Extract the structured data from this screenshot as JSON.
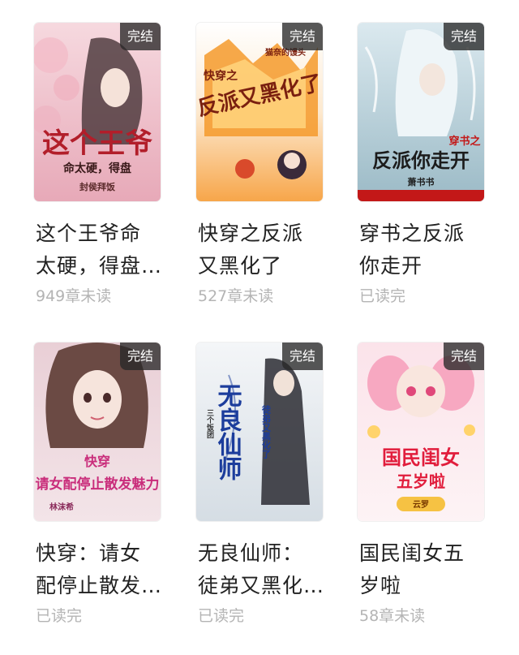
{
  "badge_label": "完结",
  "books": [
    {
      "title_line1": "这个王爷命",
      "title_line2": "太硬，得盘…",
      "status": "949章未读",
      "cover": {
        "main_text": "这个王爷",
        "sub_text": "命太硬，得盘",
        "author": "封侯拜饭",
        "bg_top": "#f6d9df",
        "bg_bottom": "#e7a9b8",
        "accent": "#b21e2a"
      }
    },
    {
      "title_line1": "快穿之反派",
      "title_line2": "又黑化了",
      "status": "527章未读",
      "cover": {
        "main_text": "反派又黑化了",
        "sub_text": "快穿之",
        "author": "猫奈的馒头",
        "bg_top": "#ffffff",
        "bg_bottom": "#f7a64a",
        "accent": "#7a1f0f"
      }
    },
    {
      "title_line1": "穿书之反派",
      "title_line2": "你走开",
      "status": "已读完",
      "cover": {
        "main_text": "反派你走开",
        "sub_text": "穿书之",
        "author": "萧书书",
        "bg_top": "#dbe9ef",
        "bg_bottom": "#9bbac6",
        "accent": "#1c1c1c"
      }
    },
    {
      "title_line1": "快穿：请女",
      "title_line2": "配停止散发…",
      "status": "已读完",
      "cover": {
        "main_text": "请女配停止散发魅力",
        "sub_text": "快穿",
        "author": "林沫希",
        "bg_top": "#e9cfd6",
        "bg_bottom": "#f3e4e8",
        "accent": "#c92d7b"
      }
    },
    {
      "title_line1": "无良仙师：",
      "title_line2": "徒弟又黑化…",
      "status": "已读完",
      "cover": {
        "main_text": "无良仙师",
        "sub_text": "徒弟又黑化了",
        "author": "三个饭团",
        "bg_top": "#f4f6f8",
        "bg_bottom": "#d5dde4",
        "accent": "#1c3d9c"
      }
    },
    {
      "title_line1": "国民闺女五",
      "title_line2": "岁啦",
      "status": "58章未读",
      "cover": {
        "main_text": "国民闺女",
        "sub_text": "五岁啦",
        "author": "云罗",
        "bg_top": "#fbe3ea",
        "bg_bottom": "#fdf3f5",
        "accent": "#e11d3c"
      }
    }
  ]
}
